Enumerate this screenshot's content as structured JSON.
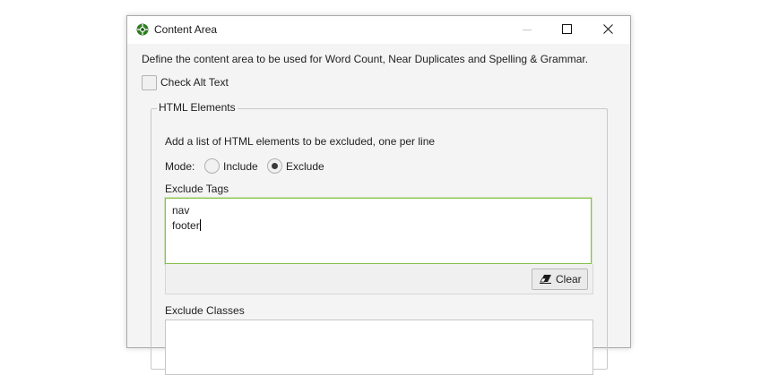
{
  "window": {
    "title": "Content Area",
    "app_icon": "spider-icon",
    "controls": [
      "minimize-icon",
      "maximize-icon",
      "close-icon"
    ]
  },
  "description": "Define the content area to be used for Word Count, Near Duplicates and Spelling & Grammar.",
  "check_alt_text": {
    "label": "Check Alt Text",
    "checked": false
  },
  "html_elements": {
    "legend": "HTML Elements",
    "instruction": "Add a list of HTML elements to be excluded, one per line",
    "mode": {
      "label": "Mode:",
      "options": [
        "Include",
        "Exclude"
      ],
      "selected": "Exclude"
    },
    "exclude_tags": {
      "label": "Exclude Tags",
      "lines": [
        "nav",
        "footer"
      ]
    },
    "clear_button": {
      "label": "Clear",
      "icon": "eraser-icon"
    },
    "exclude_classes": {
      "label": "Exclude Classes",
      "value": ""
    }
  },
  "colors": {
    "focus_border": "#86c24a",
    "window_bg": "#f4f4f4"
  }
}
